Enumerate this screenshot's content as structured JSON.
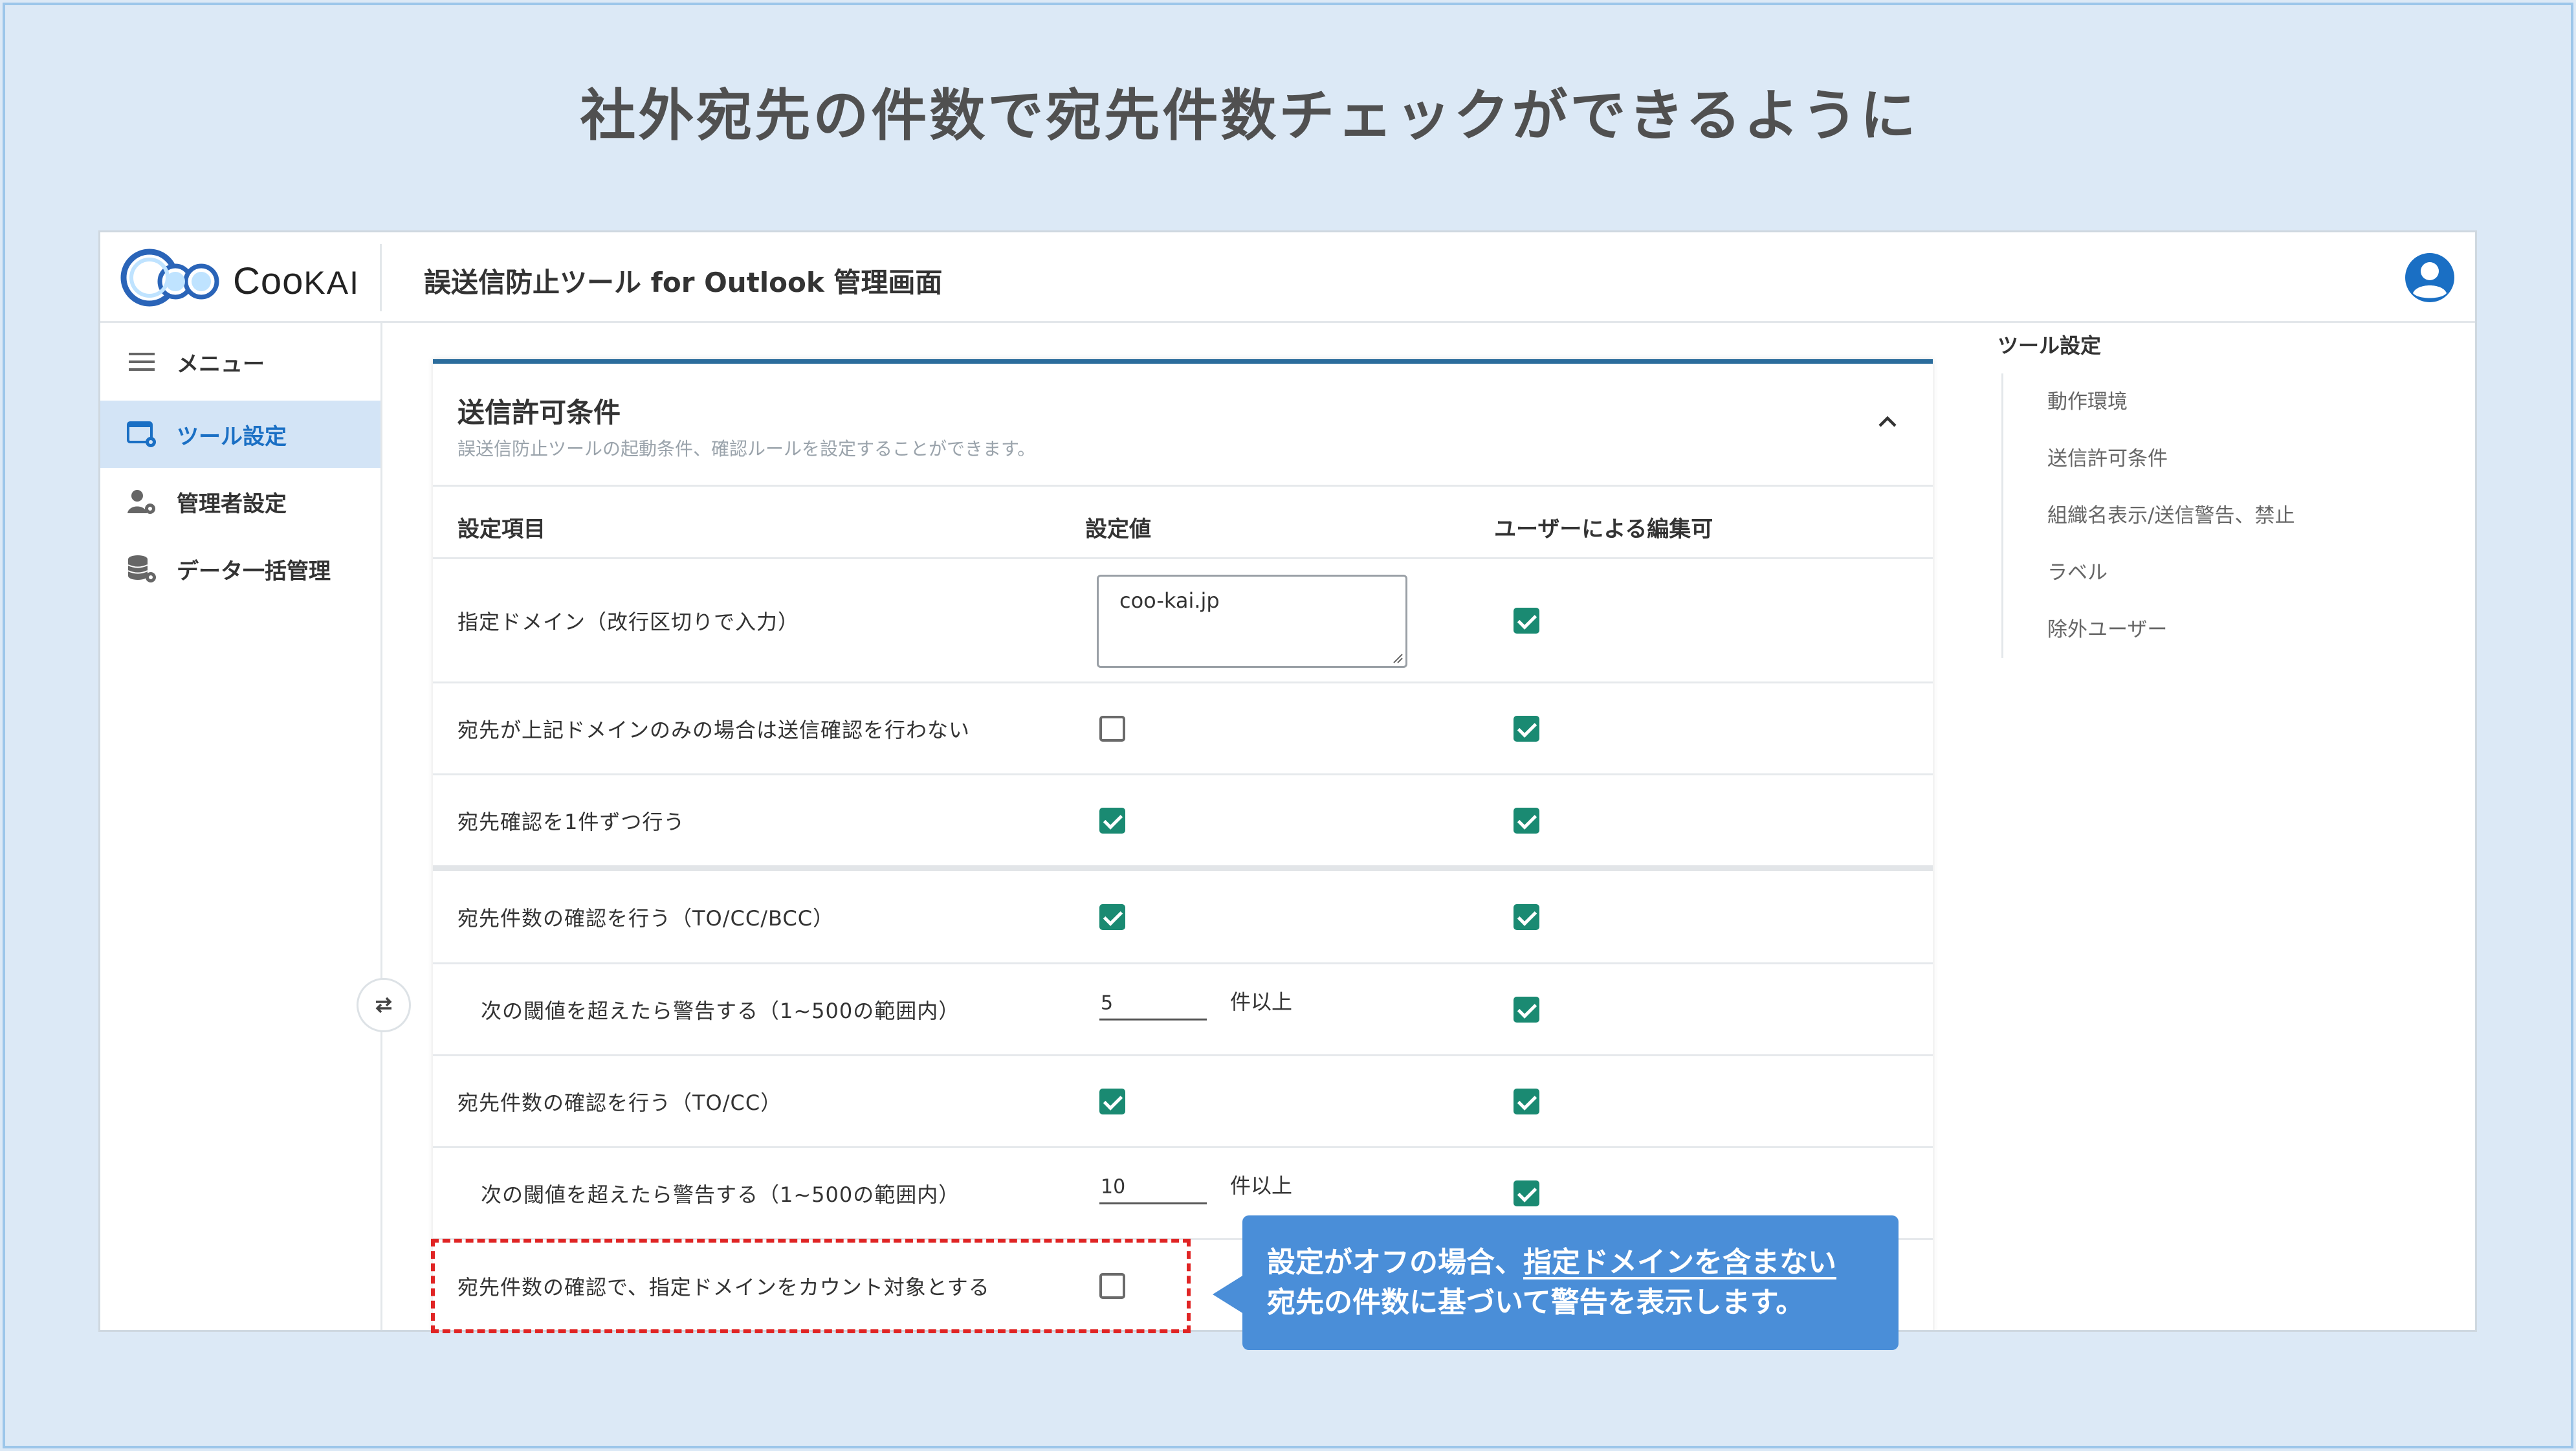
{
  "headline": "社外宛先の件数で宛先件数チェックができるように",
  "header": {
    "logo_text_main": "Coo",
    "logo_text_sub": "KAI",
    "title": "誤送信防止ツール for Outlook 管理画面",
    "user_icon": "account-circle-icon"
  },
  "sidebar": {
    "menu_label": "メニュー",
    "items": [
      {
        "label": "ツール設定",
        "icon": "tool-settings-icon",
        "active": true
      },
      {
        "label": "管理者設定",
        "icon": "admin-settings-icon",
        "active": false
      },
      {
        "label": "データ一括管理",
        "icon": "database-settings-icon",
        "active": false
      }
    ]
  },
  "card": {
    "title": "送信許可条件",
    "subtitle": "誤送信防止ツールの起動条件、確認ルールを設定することができます。",
    "columns": [
      "設定項目",
      "設定値",
      "ユーザーによる編集可"
    ],
    "rows": [
      {
        "label": "指定ドメイン（改行区切りで入力）",
        "type": "textarea",
        "value": "coo-kai.jp",
        "user_editable": true
      },
      {
        "label": "宛先が上記ドメインのみの場合は送信確認を行わない",
        "type": "checkbox",
        "value": false,
        "user_editable": true
      },
      {
        "label": "宛先確認を1件ずつ行う",
        "type": "checkbox",
        "value": true,
        "user_editable": true
      },
      {
        "label": "宛先件数の確認を行う（TO/CC/BCC）",
        "type": "checkbox",
        "value": true,
        "user_editable": true
      },
      {
        "label": "次の閾値を超えたら警告する（1~500の範囲内）",
        "type": "number",
        "value": "5",
        "suffix": "件以上",
        "user_editable": true
      },
      {
        "label": "宛先件数の確認を行う（TO/CC）",
        "type": "checkbox",
        "value": true,
        "user_editable": true
      },
      {
        "label": "次の閾値を超えたら警告する（1~500の範囲内）",
        "type": "number",
        "value": "10",
        "suffix": "件以上",
        "user_editable": true
      },
      {
        "label": "宛先件数の確認で、指定ドメインをカウント対象とする",
        "type": "checkbox",
        "value": false
      }
    ]
  },
  "toc": {
    "title": "ツール設定",
    "items": [
      "動作環境",
      "送信許可条件",
      "組織名表示/送信警告、禁止",
      "ラベル",
      "除外ユーザー"
    ]
  },
  "callout": {
    "line1_prefix": "設定がオフの場合、",
    "line1_underlined": "指定ドメインを含まない",
    "line2": "宛先の件数に基づいて警告を表示します。"
  },
  "colors": {
    "accent_blue": "#1a6fc4",
    "check_green": "#1a8a72",
    "callout_blue": "#4a8ed8",
    "highlight_red": "#e02424"
  }
}
